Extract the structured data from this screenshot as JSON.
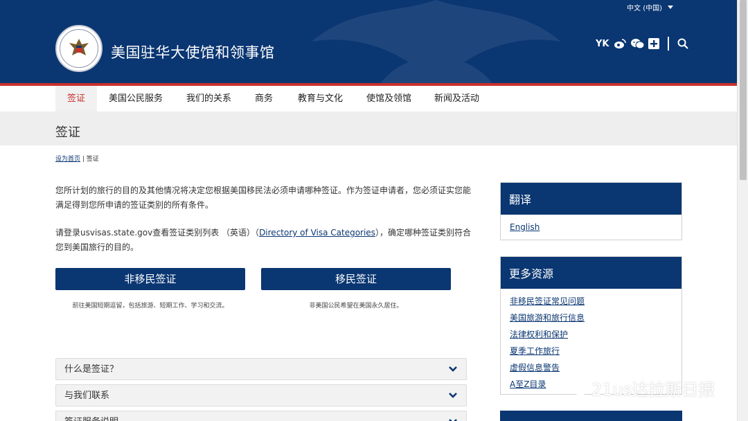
{
  "header": {
    "language": "中文 (中国)",
    "site_title": "美国驻华大使馆和领事馆",
    "social_text": "YK"
  },
  "nav": {
    "items": [
      "签证",
      "美国公民服务",
      "我们的关系",
      "商务",
      "教育与文化",
      "使馆及领馆",
      "新闻及活动"
    ]
  },
  "page": {
    "title": "签证",
    "breadcrumb_home": "设为首页",
    "breadcrumb_sep": " | ",
    "breadcrumb_current": "签证",
    "para1": "您所计划的旅行的目的及其他情况将决定您根据美国移民法必须申请哪种签证。作为签证申请者，您必须证实您能满足得到您所申请的签证类别的所有条件。",
    "para2_pre": "请登录usvisas.state.gov查看签证类别列表 （英语）（",
    "para2_link": "Directory of Visa Categories",
    "para2_post": "），确定哪种签证类别符合您到美国旅行的目的。"
  },
  "buttons": {
    "nonimmigrant": "非移民签证",
    "nonimmigrant_desc": "前往美国短期逗留，包括旅游、短期工作、学习和交流。",
    "immigrant": "移民签证",
    "immigrant_desc": "非美国公民希望在美国永久居住。"
  },
  "accordion": [
    "什么是签证？",
    "与我们联系",
    "签证服务说明"
  ],
  "sidebar": {
    "translate_title": "翻译",
    "translate_link": "English",
    "resources_title": "更多资源",
    "resources": [
      "非移民签证常见问题",
      "美国旅游和旅行信息",
      "法律权利和保护",
      "夏季工作旅行",
      "虚假信息警告",
      "A至Z目录"
    ]
  },
  "watermark": "21us达拉斯日报",
  "colors": {
    "navy": "#0a3672",
    "red": "#c9302c"
  }
}
